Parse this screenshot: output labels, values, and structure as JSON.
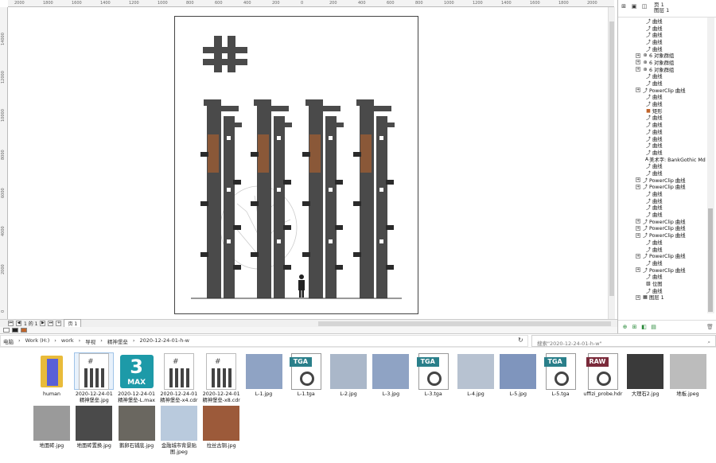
{
  "ruler": {
    "top": [
      "2000",
      "1800",
      "1600",
      "1400",
      "1200",
      "1000",
      "800",
      "600",
      "400",
      "200",
      "0",
      "200",
      "400",
      "600",
      "800",
      "1000",
      "1200",
      "1400",
      "1600",
      "1800",
      "2000"
    ],
    "left": [
      "14000",
      "12000",
      "10000",
      "8000",
      "6000",
      "4000",
      "2000",
      "0"
    ]
  },
  "objects_panel": {
    "page_label": "页 1",
    "layer_label": "图层 1",
    "rows": [
      {
        "text": "曲线",
        "icon": "curve",
        "exp": false
      },
      {
        "text": "曲线",
        "icon": "curve",
        "exp": false
      },
      {
        "text": "曲线",
        "icon": "curve",
        "exp": false
      },
      {
        "text": "曲线",
        "icon": "curve",
        "exp": false
      },
      {
        "text": "曲线",
        "icon": "curve",
        "exp": false
      },
      {
        "text": "6 对象群组",
        "icon": "group",
        "exp": true
      },
      {
        "text": "6 对象群组",
        "icon": "group",
        "exp": true
      },
      {
        "text": "6 对象群组",
        "icon": "group",
        "exp": true
      },
      {
        "text": "曲线",
        "icon": "curve",
        "exp": false
      },
      {
        "text": "曲线",
        "icon": "curve",
        "exp": false
      },
      {
        "text": "PowerClip 曲线",
        "icon": "curve",
        "exp": true
      },
      {
        "text": "曲线",
        "icon": "curve",
        "exp": false
      },
      {
        "text": "曲线",
        "icon": "curve",
        "exp": false
      },
      {
        "text": "矩形",
        "icon": "rect",
        "exp": false
      },
      {
        "text": "曲线",
        "icon": "curve",
        "exp": false
      },
      {
        "text": "曲线",
        "icon": "curve",
        "exp": false
      },
      {
        "text": "曲线",
        "icon": "curve",
        "exp": false
      },
      {
        "text": "曲线",
        "icon": "curve",
        "exp": false
      },
      {
        "text": "曲线",
        "icon": "curve",
        "exp": false
      },
      {
        "text": "曲线",
        "icon": "curve",
        "exp": false
      },
      {
        "text": "美术字: BankGothic Md BT",
        "icon": "text",
        "exp": false
      },
      {
        "text": "曲线",
        "icon": "curve",
        "exp": false
      },
      {
        "text": "曲线",
        "icon": "curve",
        "exp": false
      },
      {
        "text": "PowerClip 曲线",
        "icon": "curve",
        "exp": true
      },
      {
        "text": "PowerClip 曲线",
        "icon": "curve",
        "exp": true
      },
      {
        "text": "曲线",
        "icon": "curve",
        "exp": false
      },
      {
        "text": "曲线",
        "icon": "curve",
        "exp": false
      },
      {
        "text": "曲线",
        "icon": "curve",
        "exp": false
      },
      {
        "text": "曲线",
        "icon": "curve",
        "exp": false
      },
      {
        "text": "PowerClip 曲线",
        "icon": "curve",
        "exp": true
      },
      {
        "text": "PowerClip 曲线",
        "icon": "curve",
        "exp": true
      },
      {
        "text": "PowerClip 曲线",
        "icon": "curve",
        "exp": true
      },
      {
        "text": "曲线",
        "icon": "curve",
        "exp": false
      },
      {
        "text": "曲线",
        "icon": "curve",
        "exp": false
      },
      {
        "text": "PowerClip 曲线",
        "icon": "curve",
        "exp": true
      },
      {
        "text": "曲线",
        "icon": "curve",
        "exp": false
      },
      {
        "text": "PowerClip 曲线",
        "icon": "curve",
        "exp": true
      },
      {
        "text": "曲线",
        "icon": "curve",
        "exp": false
      },
      {
        "text": "位图",
        "icon": "bitmap",
        "exp": false
      },
      {
        "text": "曲线",
        "icon": "curve",
        "exp": false
      },
      {
        "text": "图层 1",
        "icon": "layer",
        "exp": true
      }
    ]
  },
  "pagebar": {
    "page_count": "1 的 1",
    "tab": "页 1"
  },
  "explorer": {
    "breadcrumb": [
      "电脑",
      "Work (H:)",
      "work",
      "导视",
      "精神堡垒",
      "2020-12-24-01-h-w"
    ],
    "search_placeholder": "搜索\"2020-12-24-01-h-w\"",
    "files": [
      {
        "name": "human",
        "kind": "folder"
      },
      {
        "name": "2020-12-24-01 精神堡垒.jpg",
        "kind": "doc"
      },
      {
        "name": "2020-12-24-01 精神堡垒-L.max",
        "kind": "max"
      },
      {
        "name": "2020-12-24-01 精神堡垒-x4.cdr",
        "kind": "doc"
      },
      {
        "name": "2020-12-24-01 精神堡垒-x8.cdr",
        "kind": "doc"
      },
      {
        "name": "L-1.jpg",
        "kind": "photo",
        "color": "#8fa3c4"
      },
      {
        "name": "L-1.tga",
        "kind": "tga",
        "badge": "TGA"
      },
      {
        "name": "L-2.jpg",
        "kind": "photo",
        "color": "#aab7c9"
      },
      {
        "name": "L-3.jpg",
        "kind": "photo",
        "color": "#8fa3c4"
      },
      {
        "name": "L-3.tga",
        "kind": "tga",
        "badge": "TGA"
      },
      {
        "name": "L-4.jpg",
        "kind": "photo",
        "color": "#b7c2d1"
      },
      {
        "name": "L-5.jpg",
        "kind": "photo",
        "color": "#7f95bd"
      },
      {
        "name": "L-5.tga",
        "kind": "tga",
        "badge": "TGA"
      },
      {
        "name": "uffizi_probe.hdr",
        "kind": "tga",
        "badge": "RAW"
      },
      {
        "name": "大理石2.jpg",
        "kind": "photo",
        "color": "#3a3a3a"
      },
      {
        "name": "地板.jpeg",
        "kind": "photo",
        "color": "#bcbcbc"
      },
      {
        "name": "地面砖.jpg",
        "kind": "photo",
        "color": "#9a9a9a"
      },
      {
        "name": "地面砖置换.jpg",
        "kind": "photo",
        "color": "#4a4a4a"
      },
      {
        "name": "鹅卵石铺底.jpg",
        "kind": "photo",
        "color": "#6a6760"
      },
      {
        "name": "金融城市背景贴图.jpeg",
        "kind": "photo",
        "color": "#b9cadd"
      },
      {
        "name": "拉丝古铜.jpg",
        "kind": "photo",
        "color": "#9c5a3a"
      }
    ]
  },
  "colors": {
    "pillar": "#4a4a4a",
    "accent": "#c0642a",
    "tga_badge": "#2a7f8a",
    "raw_badge": "#7a2a3a"
  }
}
